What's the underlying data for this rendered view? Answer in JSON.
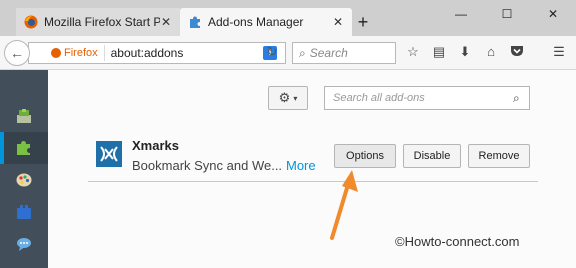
{
  "tabs": [
    {
      "title": "Mozilla Firefox Start Page",
      "close": "✕",
      "active": false
    },
    {
      "title": "Add-ons Manager",
      "close": "✕",
      "active": true
    }
  ],
  "new_tab": "+",
  "window_controls": {
    "minimize": "—",
    "maximize": "☐",
    "close": "✕"
  },
  "navbar": {
    "back": "←",
    "identity_label": "Firefox",
    "url": "about:addons",
    "info_badge": "i",
    "reload": "↻",
    "search_placeholder": "Search",
    "icons": [
      "bookmark-star-icon",
      "reading-list-icon",
      "download-icon",
      "home-icon",
      "pocket-icon",
      "hamburger-menu-icon"
    ]
  },
  "sidebar": {
    "categories": [
      {
        "name": "get-add-ons",
        "selected": false
      },
      {
        "name": "extensions",
        "selected": true
      },
      {
        "name": "appearance",
        "selected": false
      },
      {
        "name": "plugins",
        "selected": false
      },
      {
        "name": "services",
        "selected": false
      }
    ]
  },
  "toolbar": {
    "gear_caret": "▾",
    "search_placeholder": "Search all add-ons"
  },
  "addon": {
    "name": "Xmarks",
    "description": "Bookmark Sync and We...",
    "more": "More",
    "options_label": "Options",
    "disable_label": "Disable",
    "remove_label": "Remove"
  },
  "watermark": "©Howto-connect.com",
  "colors": {
    "accent": "#0095dd",
    "sidebar_bg": "#424f5a",
    "arrow": "#f08a2c"
  }
}
